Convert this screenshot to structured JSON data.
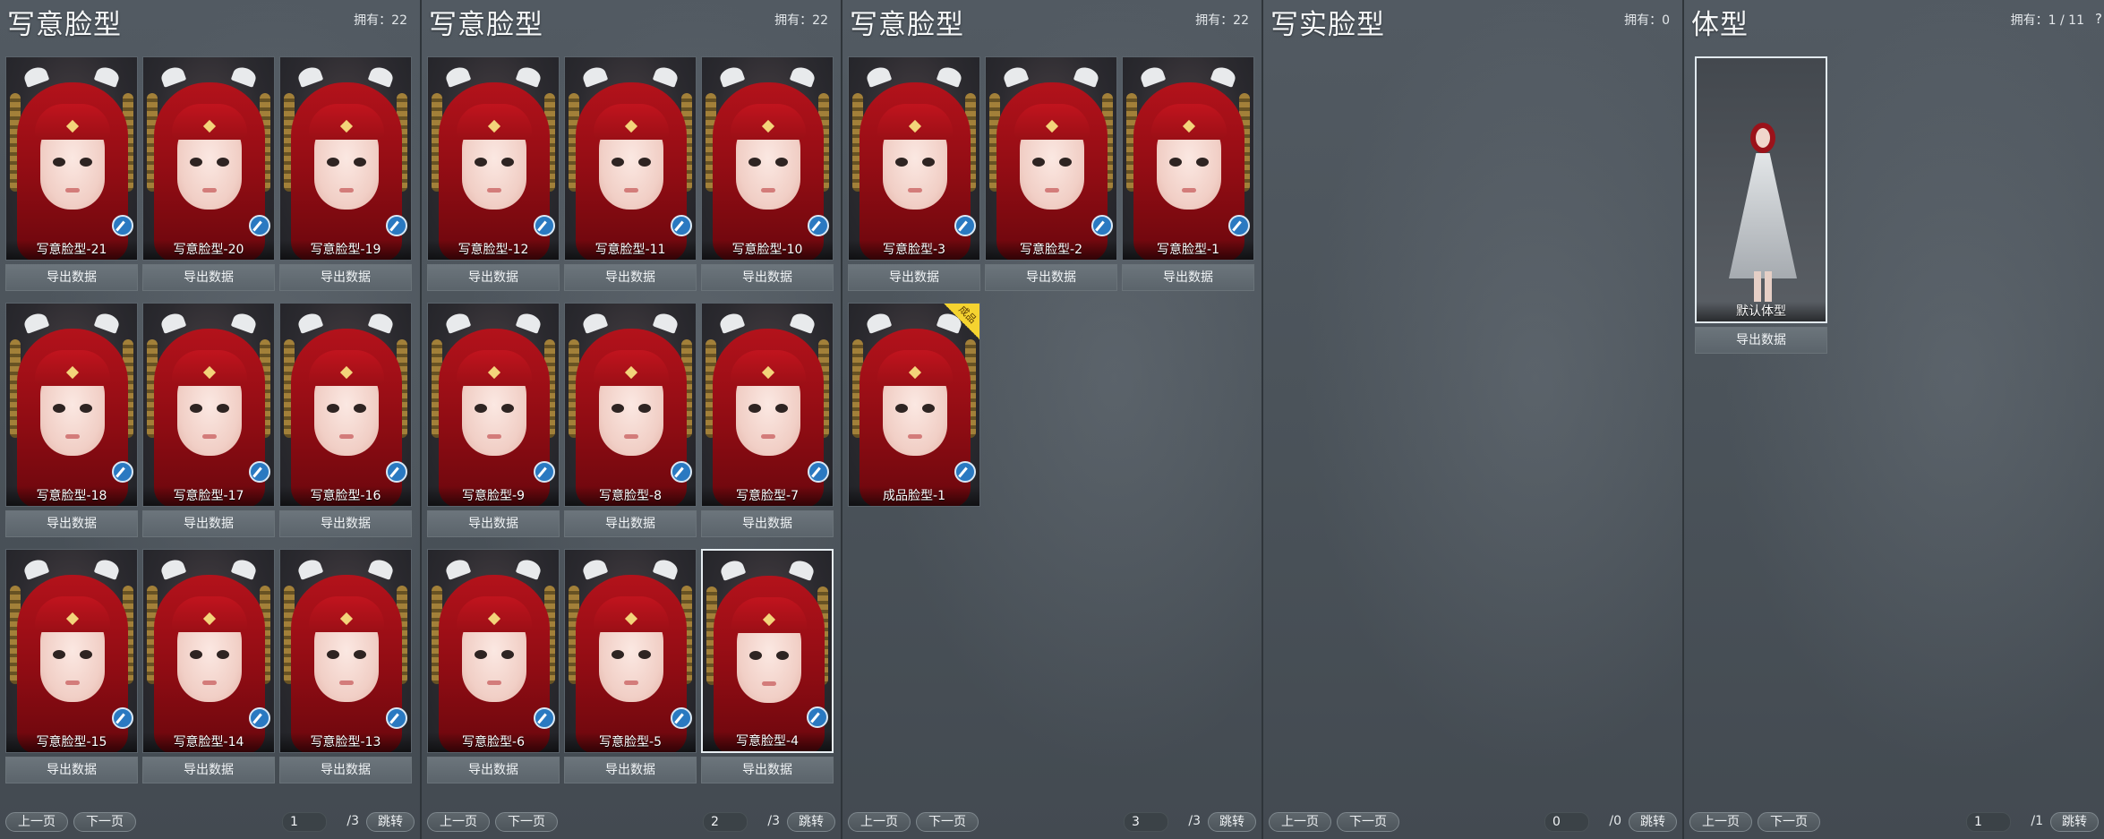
{
  "common": {
    "export_label": "导出数据",
    "prev_label": "上一页",
    "next_label": "下一页",
    "jump_label": "跳转"
  },
  "panels": [
    {
      "title": "写意脸型",
      "owned": "拥有：22",
      "page": "1",
      "total": "/3",
      "cards": [
        "写意脸型-21",
        "写意脸型-20",
        "写意脸型-19",
        "写意脸型-18",
        "写意脸型-17",
        "写意脸型-16",
        "写意脸型-15",
        "写意脸型-14",
        "写意脸型-13"
      ]
    },
    {
      "title": "写意脸型",
      "owned": "拥有：22",
      "page": "2",
      "total": "/3",
      "cards": [
        "写意脸型-12",
        "写意脸型-11",
        "写意脸型-10",
        "写意脸型-9",
        "写意脸型-8",
        "写意脸型-7",
        "写意脸型-6",
        "写意脸型-5",
        "写意脸型-4"
      ]
    },
    {
      "title": "写意脸型",
      "owned": "拥有：22",
      "page": "3",
      "total": "/3",
      "cards": [
        "写意脸型-3",
        "写意脸型-2",
        "写意脸型-1",
        "成品脸型-1"
      ],
      "badge": "成品"
    },
    {
      "title": "写实脸型",
      "owned": "拥有：0",
      "page": "0",
      "total": "/0",
      "cards": []
    },
    {
      "title": "体型",
      "owned": "拥有：1 / 11",
      "help": "?",
      "page": "1",
      "total": "/1",
      "cards": [
        "默认体型"
      ]
    }
  ]
}
